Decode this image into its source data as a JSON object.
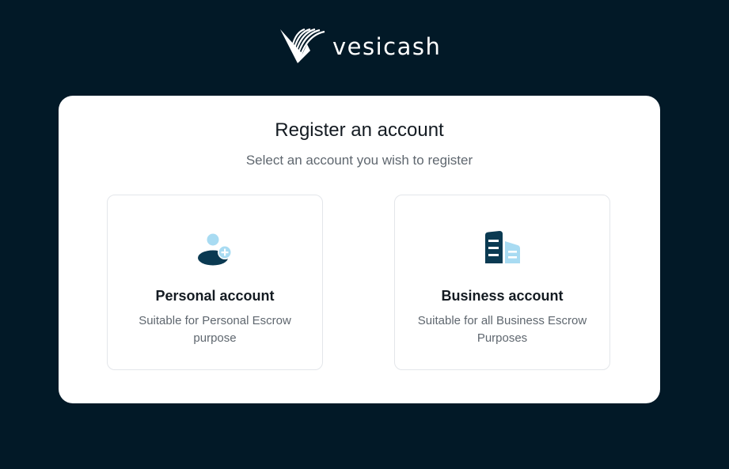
{
  "brand": {
    "name": "vesicash",
    "logo_icon": "vesicash-v-logo"
  },
  "colors": {
    "background": "#021927",
    "card": "#ffffff",
    "icon_dark": "#0b3a52",
    "icon_light": "#a8dbf2"
  },
  "register": {
    "title": "Register an account",
    "subtitle": "Select an account you wish to register",
    "options": [
      {
        "icon": "user-add-icon",
        "title": "Personal account",
        "description": "Suitable for Personal Escrow purpose"
      },
      {
        "icon": "building-icon",
        "title": "Business account",
        "description": "Suitable for all Business Escrow Purposes"
      }
    ]
  }
}
